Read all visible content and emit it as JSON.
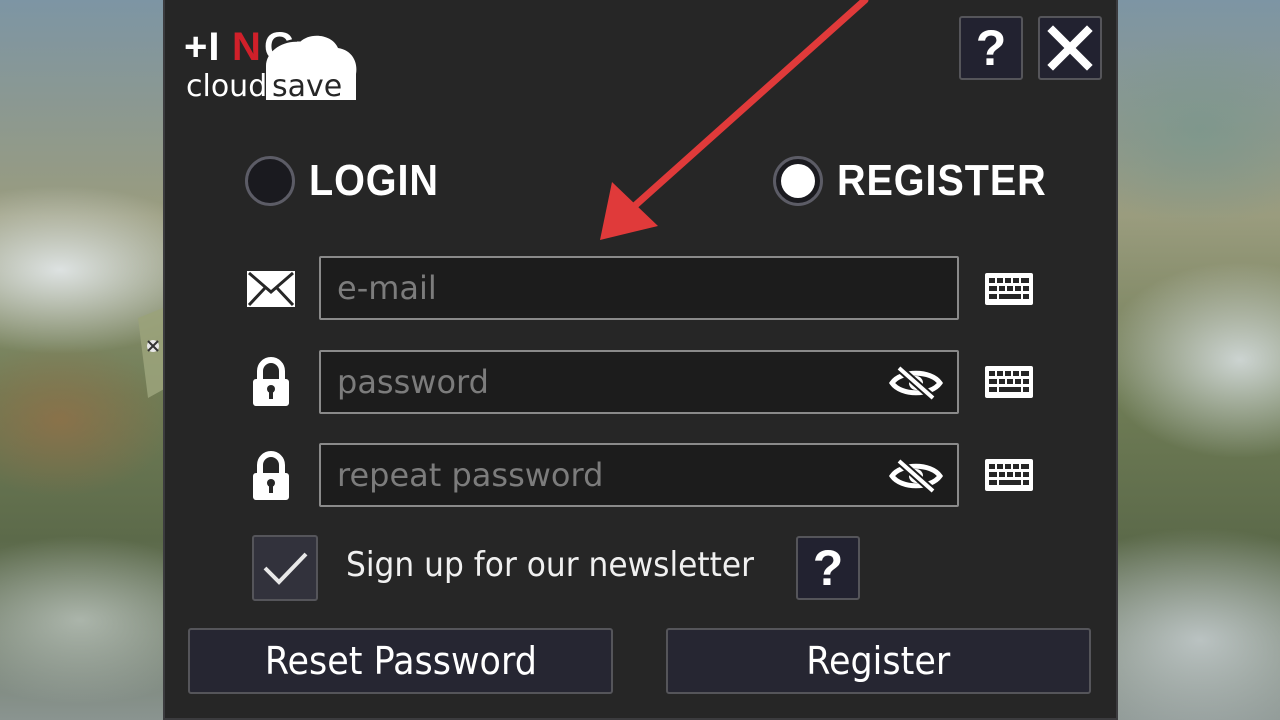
{
  "header": {
    "logo_text_top": "+ING",
    "logo_text_cloud": "cloud",
    "logo_text_save": "save",
    "help_label": "?",
    "close_label": "✕"
  },
  "mode": {
    "login_label": "LOGIN",
    "register_label": "REGISTER",
    "selected": "register"
  },
  "form": {
    "email": {
      "value": "",
      "placeholder": "e-mail",
      "icon": "envelope-icon"
    },
    "password": {
      "value": "",
      "placeholder": "password",
      "icon": "lock-icon"
    },
    "repeat_password": {
      "value": "",
      "placeholder": "repeat password",
      "icon": "lock-icon"
    },
    "keyboard_icon": "keyboard-icon",
    "visibility_icon": "eye-slash-icon"
  },
  "newsletter": {
    "checked": true,
    "label": "Sign up for our newsletter",
    "help_label": "?"
  },
  "buttons": {
    "reset_label": "Reset Password",
    "register_label": "Register"
  },
  "colors": {
    "panel": "#262626",
    "button_bg": "#262632",
    "logo_red": "#d0202a",
    "annotation_arrow": "#e03a3a"
  }
}
